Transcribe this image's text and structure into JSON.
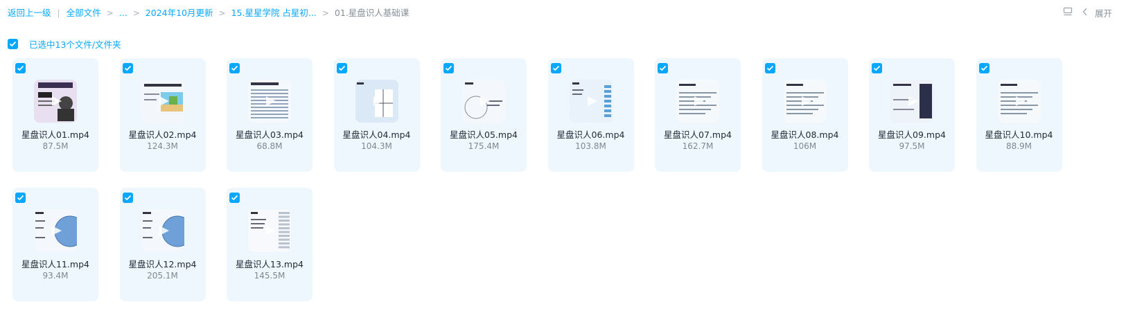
{
  "breadcrumb": {
    "back": "返回上一级",
    "separator": "|",
    "all_files": "全部文件",
    "ellipsis": "...",
    "folder1": "2024年10月更新",
    "folder2": "15.星星学院 占星初...",
    "current": "01.星盘识人基础课"
  },
  "toolbar": {
    "expand_label": "展开"
  },
  "selection": {
    "label": "已选中13个文件/文件夹"
  },
  "files": [
    {
      "name": "星盘识人01.mp4",
      "size": "87.5M",
      "thumb": "portrait"
    },
    {
      "name": "星盘识人02.mp4",
      "size": "124.3M",
      "thumb": "beach"
    },
    {
      "name": "星盘识人03.mp4",
      "size": "68.8M",
      "thumb": "table"
    },
    {
      "name": "星盘识人04.mp4",
      "size": "104.3M",
      "thumb": "diagram"
    },
    {
      "name": "星盘识人05.mp4",
      "size": "175.4M",
      "thumb": "circle"
    },
    {
      "name": "星盘识人06.mp4",
      "size": "103.8M",
      "thumb": "columns"
    },
    {
      "name": "星盘识人07.mp4",
      "size": "162.7M",
      "thumb": "text"
    },
    {
      "name": "星盘识人08.mp4",
      "size": "106M",
      "thumb": "text"
    },
    {
      "name": "星盘识人09.mp4",
      "size": "97.5M",
      "thumb": "dark"
    },
    {
      "name": "星盘识人10.mp4",
      "size": "88.9M",
      "thumb": "text"
    },
    {
      "name": "星盘识人11.mp4",
      "size": "93.4M",
      "thumb": "wheel"
    },
    {
      "name": "星盘识人12.mp4",
      "size": "205.1M",
      "thumb": "wheel"
    },
    {
      "name": "星盘识人13.mp4",
      "size": "145.5M",
      "thumb": "sheet"
    }
  ],
  "colors": {
    "accent": "#06a7ff",
    "card_bg": "#eef7fe"
  }
}
